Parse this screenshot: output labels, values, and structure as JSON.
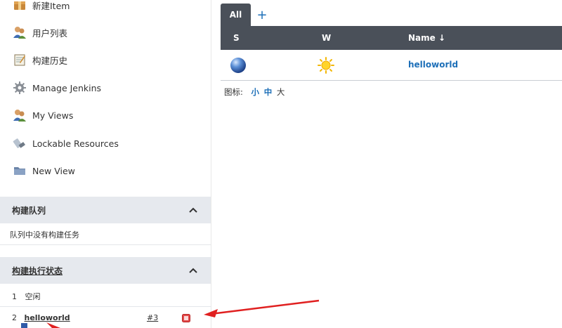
{
  "sidebar": {
    "items": [
      {
        "label": "新建Item",
        "icon": "new-item-icon"
      },
      {
        "label": "用户列表",
        "icon": "users-icon"
      },
      {
        "label": "构建历史",
        "icon": "notepad-icon"
      },
      {
        "label": "Manage Jenkins",
        "icon": "gear-icon"
      },
      {
        "label": "My Views",
        "icon": "users-icon"
      },
      {
        "label": "Lockable Resources",
        "icon": "usb-icon"
      },
      {
        "label": "New View",
        "icon": "folder-icon"
      }
    ],
    "build_queue": {
      "title": "构建队列",
      "empty_text": "队列中没有构建任务"
    },
    "executors": {
      "title": "构建执行状态",
      "rows": [
        {
          "index": "1",
          "status": "空闲"
        },
        {
          "index": "2",
          "job": "helloworld",
          "build": "#3"
        }
      ]
    }
  },
  "main": {
    "tabs": [
      {
        "label": "All"
      }
    ],
    "add_tab": "+",
    "columns": {
      "s": "S",
      "w": "W",
      "name": "Name ↓"
    },
    "jobs": [
      {
        "status_icon": "blue-ball-icon",
        "weather_icon": "sunny-icon",
        "name": "helloworld"
      }
    ],
    "icon_size": {
      "label": "图标:",
      "small": "小",
      "medium": "中",
      "large": "大"
    }
  },
  "colors": {
    "header_bg": "#4a5059",
    "panel_bg": "#e6e9ee",
    "link": "#1d6fb8",
    "annotation": "#e02020"
  }
}
